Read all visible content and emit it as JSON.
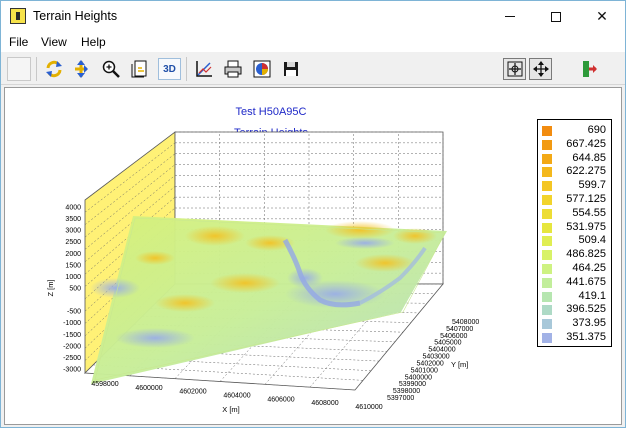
{
  "window": {
    "title": "Terrain Heights"
  },
  "menu": {
    "items": [
      "File",
      "View",
      "Help"
    ]
  },
  "toolbar": {
    "buttons": [
      {
        "name": "blank-button-icon"
      },
      {
        "name": "rotate-icon"
      },
      {
        "name": "pan-icon"
      },
      {
        "name": "zoom-icon"
      },
      {
        "name": "page-icon"
      },
      {
        "name": "3d-toggle",
        "label": "3D"
      },
      {
        "name": "axes-icon"
      },
      {
        "name": "print-icon"
      },
      {
        "name": "color-palette-icon"
      },
      {
        "name": "save-icon"
      },
      {
        "name": "fit-icon"
      },
      {
        "name": "move-icon"
      },
      {
        "name": "exit-icon"
      }
    ]
  },
  "colors": {
    "title_text": "#1e28c8",
    "wall": "#fff176",
    "floor": "#ffffff"
  },
  "chart_data": {
    "type": "surface3d",
    "title": "Test H50A95C",
    "subtitle": "Terrain Heights",
    "xlabel": "X [m]",
    "ylabel": "Y [m]",
    "zlabel": "Z [m]",
    "x_ticks": [
      "4598000",
      "4600000",
      "4602000",
      "4604000",
      "4606000",
      "4608000",
      "4610000"
    ],
    "y_ticks": [
      "5397000",
      "5398000",
      "5399000",
      "5400000",
      "5401000",
      "5402000",
      "5403000",
      "5404000",
      "5405000",
      "5406000",
      "5407000",
      "5408000"
    ],
    "z_ticks": [
      "4000",
      "3500",
      "3000",
      "2500",
      "2000",
      "1500",
      "1000",
      "500",
      "",
      "-500",
      "-1000",
      "-1500",
      "-2000",
      "-2500",
      "-3000"
    ],
    "legend": [
      {
        "value": "690",
        "color": "#f28c10"
      },
      {
        "value": "667.425",
        "color": "#f29a12"
      },
      {
        "value": "644.85",
        "color": "#f3a916"
      },
      {
        "value": "622.275",
        "color": "#f4b81c"
      },
      {
        "value": "599.7",
        "color": "#f4c624"
      },
      {
        "value": "577.125",
        "color": "#f2d42c"
      },
      {
        "value": "554.55",
        "color": "#eddd35"
      },
      {
        "value": "531.975",
        "color": "#e6e63e"
      },
      {
        "value": "509.4",
        "color": "#e0ee52"
      },
      {
        "value": "486.825",
        "color": "#d8f268"
      },
      {
        "value": "464.25",
        "color": "#cef282"
      },
      {
        "value": "441.675",
        "color": "#c2ee9b"
      },
      {
        "value": "419.1",
        "color": "#b6e6b0"
      },
      {
        "value": "396.525",
        "color": "#aedac6"
      },
      {
        "value": "373.95",
        "color": "#a8c8d9"
      },
      {
        "value": "351.375",
        "color": "#a2b2e6"
      }
    ]
  }
}
